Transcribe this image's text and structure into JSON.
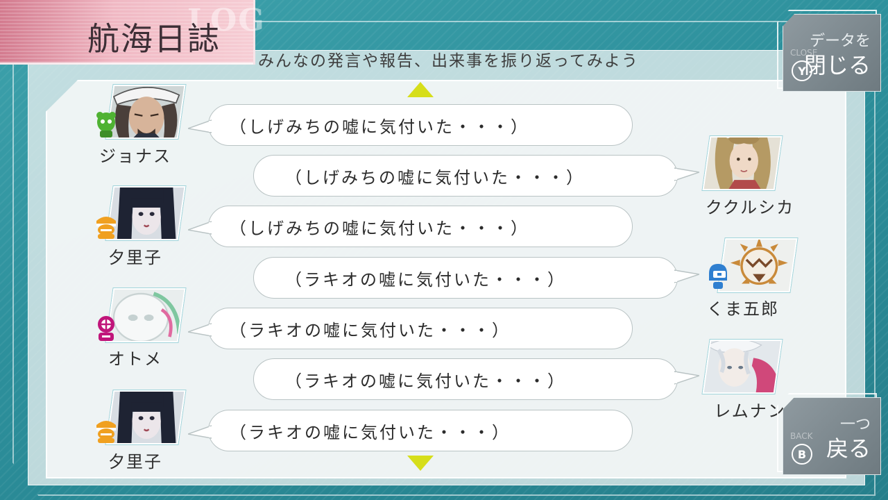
{
  "header": {
    "title": "航海日誌",
    "title_ghost": "LOG",
    "subtitle": "みんなの発言や報告、出来事を振り返ってみよう"
  },
  "buttons": {
    "close": {
      "line1": "データを",
      "line2": "閉じる",
      "key": "Y",
      "ghost": "CLOSE"
    },
    "back": {
      "line1": "一つ",
      "line2": "戻る",
      "key": "B",
      "ghost": "BACK"
    }
  },
  "entries": [
    {
      "speaker": "ジョナス",
      "side": "left",
      "text": "（しげみちの嘘に気付いた・・・）",
      "badge_color": "#4fb233",
      "badge_icon": "green-alien-icon"
    },
    {
      "speaker": "ククルシカ",
      "side": "right",
      "text": "（しげみちの嘘に気付いた・・・）",
      "badge_color": "",
      "badge_icon": ""
    },
    {
      "speaker": "夕里子",
      "side": "left",
      "text": "（しげみちの嘘に気付いた・・・）",
      "badge_color": "#f0a020",
      "badge_icon": "orange-crewmate-icon"
    },
    {
      "speaker": "くま五郎",
      "side": "right",
      "text": "（ラキオの嘘に気付いた・・・）",
      "badge_color": "#2f7fd0",
      "badge_icon": "blue-robot-icon"
    },
    {
      "speaker": "オトメ",
      "side": "left",
      "text": "（ラキオの嘘に気付いた・・・）",
      "badge_color": "#c0157a",
      "badge_icon": "magenta-diver-icon"
    },
    {
      "speaker": "レムナン",
      "side": "right",
      "text": "（ラキオの嘘に気付いた・・・）",
      "badge_color": "",
      "badge_icon": ""
    },
    {
      "speaker": "夕里子",
      "side": "left",
      "text": "（ラキオの嘘に気付いた・・・）",
      "badge_color": "#f0a020",
      "badge_icon": "orange-crewmate-icon"
    }
  ],
  "colors": {
    "accent_arrow": "#d6de1a",
    "background": "#2c8f9b",
    "title_tab": "#e8a0b0"
  }
}
